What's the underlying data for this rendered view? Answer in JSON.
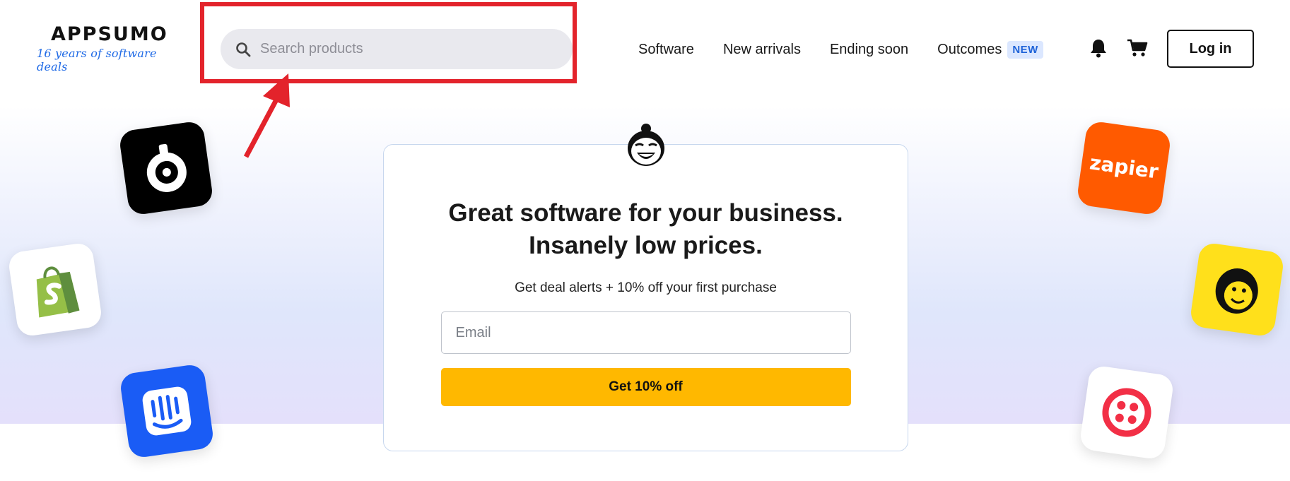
{
  "brand": {
    "name": "APPSUMO",
    "tagline": "16 years of software deals",
    "tagline_color": "#1f6ae6"
  },
  "search": {
    "placeholder": "Search products"
  },
  "nav": {
    "items": [
      {
        "label": "Software"
      },
      {
        "label": "New arrivals"
      },
      {
        "label": "Ending soon"
      },
      {
        "label": "Outcomes",
        "badge": "NEW"
      }
    ]
  },
  "header": {
    "login_label": "Log in"
  },
  "hero": {
    "title": "Great software for your business. Insanely low prices.",
    "subtitle": "Get deal alerts + 10% off your first purchase",
    "email_placeholder": "Email",
    "cta_label": "Get 10% off",
    "cta_color": "#ffb800"
  },
  "apps": {
    "zapier_label": "zapier"
  },
  "annotation": {
    "highlight_color": "#e3232b"
  }
}
